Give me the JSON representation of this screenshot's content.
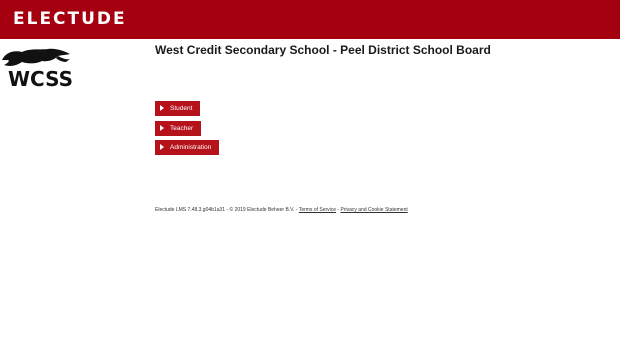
{
  "header": {
    "brand": "ELECTUDE",
    "brand_color": "#a50010"
  },
  "school": {
    "logo_text": "WCSS",
    "title": "West Credit Secondary School - Peel District School Board"
  },
  "roles": [
    {
      "label": "Student",
      "icon": "play-arrow-icon"
    },
    {
      "label": "Teacher",
      "icon": "play-arrow-icon"
    },
    {
      "label": "Administration",
      "icon": "play-arrow-icon"
    }
  ],
  "footer": {
    "version": "Electude LMS 7.48.3.g04b1a31 - © 2019 Electude Beheer B.V. -",
    "separator": "-",
    "terms": "Terms of Service",
    "privacy": "Privacy and Cookie Statement"
  }
}
